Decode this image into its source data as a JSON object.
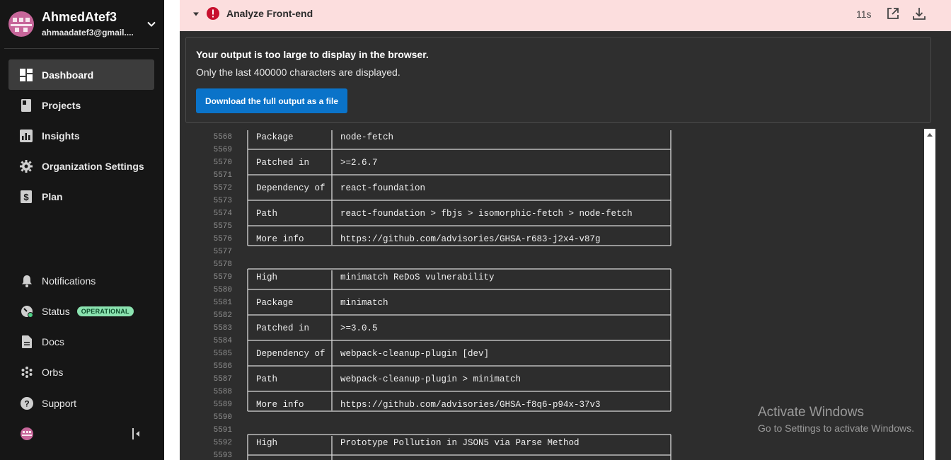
{
  "user": {
    "name": "AhmedAtef3",
    "email": "ahmaadatef3@gmail...."
  },
  "nav": {
    "primary": [
      {
        "label": "Dashboard",
        "icon": "dashboard-icon",
        "active": true
      },
      {
        "label": "Projects",
        "icon": "projects-icon"
      },
      {
        "label": "Insights",
        "icon": "insights-icon"
      },
      {
        "label": "Organization Settings",
        "icon": "gear-icon"
      },
      {
        "label": "Plan",
        "icon": "plan-dollar-icon"
      }
    ],
    "secondary": [
      {
        "label": "Notifications",
        "icon": "bell-icon"
      },
      {
        "label": "Status",
        "icon": "status-icon",
        "badge": "OPERATIONAL"
      },
      {
        "label": "Docs",
        "icon": "docs-icon"
      },
      {
        "label": "Orbs",
        "icon": "orbs-icon"
      },
      {
        "label": "Support",
        "icon": "help-icon"
      }
    ]
  },
  "job": {
    "title": "Analyze Front-end",
    "duration": "11s",
    "status_color": "#c8102e"
  },
  "warning": {
    "title": "Your output is too large to display in the browser.",
    "subtitle": "Only the last 400000 characters are displayed.",
    "button_label": "Download the full output as a file"
  },
  "log_lines": [
    {
      "n": "5568",
      "cells": [
        "Package",
        "node-fetch"
      ]
    },
    {
      "n": "5569",
      "sep": true
    },
    {
      "n": "5570",
      "cells": [
        "Patched in",
        ">=2.6.7"
      ]
    },
    {
      "n": "5571",
      "sep": true
    },
    {
      "n": "5572",
      "cells": [
        "Dependency of",
        "react-foundation"
      ]
    },
    {
      "n": "5573",
      "sep": true
    },
    {
      "n": "5574",
      "cells": [
        "Path",
        "react-foundation > fbjs > isomorphic-fetch > node-fetch"
      ]
    },
    {
      "n": "5575",
      "sep": true
    },
    {
      "n": "5576",
      "cells": [
        "More info",
        "https://github.com/advisories/GHSA-r683-j2x4-v87g"
      ]
    },
    {
      "n": "5577",
      "end": true
    },
    {
      "n": "5578",
      "start": true
    },
    {
      "n": "5579",
      "cells": [
        "High",
        "minimatch ReDoS vulnerability"
      ]
    },
    {
      "n": "5580",
      "sep": true
    },
    {
      "n": "5581",
      "cells": [
        "Package",
        "minimatch"
      ]
    },
    {
      "n": "5582",
      "sep": true
    },
    {
      "n": "5583",
      "cells": [
        "Patched in",
        ">=3.0.5"
      ]
    },
    {
      "n": "5584",
      "sep": true
    },
    {
      "n": "5585",
      "cells": [
        "Dependency of",
        "webpack-cleanup-plugin [dev]"
      ]
    },
    {
      "n": "5586",
      "sep": true
    },
    {
      "n": "5587",
      "cells": [
        "Path",
        "webpack-cleanup-plugin > minimatch"
      ]
    },
    {
      "n": "5588",
      "sep": true
    },
    {
      "n": "5589",
      "cells": [
        "More info",
        "https://github.com/advisories/GHSA-f8q6-p94x-37v3"
      ]
    },
    {
      "n": "5590",
      "end": true
    },
    {
      "n": "5591",
      "start": true
    },
    {
      "n": "5592",
      "cells": [
        "High",
        "Prototype Pollution in JSON5 via Parse Method"
      ]
    },
    {
      "n": "5593",
      "sep": true
    }
  ],
  "watermark": {
    "line1": "Activate Windows",
    "line2": "Go to Settings to activate Windows."
  }
}
